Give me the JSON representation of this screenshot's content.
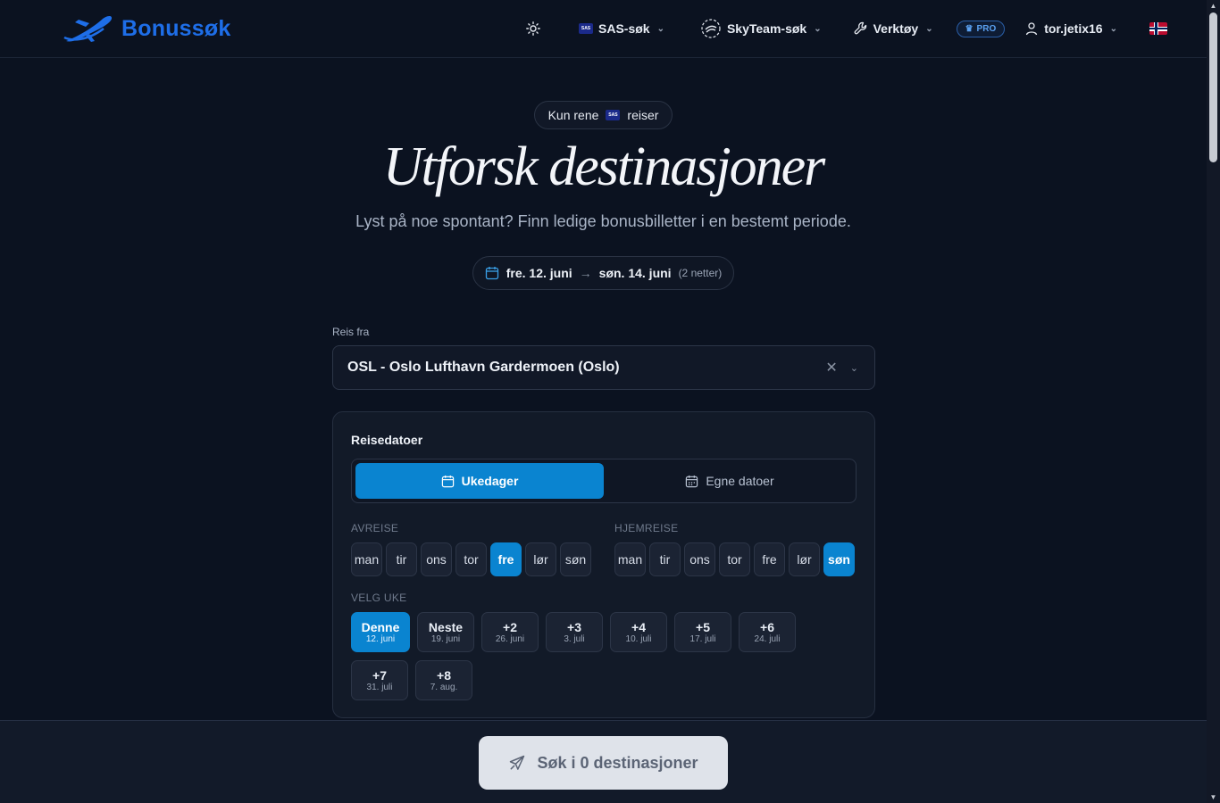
{
  "header": {
    "logo_text": "Bonussøk",
    "nav": {
      "sas": "SAS-søk",
      "skyteam": "SkyTeam-søk",
      "tools": "Verktøy",
      "pro": "PRO",
      "user": "tor.jetix16"
    },
    "sas_badge": "SAS"
  },
  "hero": {
    "pill_before": "Kun rene",
    "pill_after": "reiser",
    "title": "Utforsk destinasjoner",
    "subtitle": "Lyst på noe spontant? Finn ledige bonusbilletter i en bestemt periode.",
    "date_from": "fre. 12. juni",
    "date_to": "søn. 14. juni",
    "nights": "(2 netter)"
  },
  "from": {
    "label": "Reis fra",
    "value": "OSL - Oslo Lufthavn Gardermoen (Oslo)"
  },
  "travel_dates": {
    "title": "Reisedatoer",
    "tab_weekdays": "Ukedager",
    "tab_custom": "Egne datoer",
    "departure_label": "AVREISE",
    "return_label": "HJEMREISE",
    "departure_days": [
      "man",
      "tir",
      "ons",
      "tor",
      "fre",
      "lør",
      "søn"
    ],
    "departure_selected": "fre",
    "return_days": [
      "man",
      "tir",
      "ons",
      "tor",
      "fre",
      "lør",
      "søn"
    ],
    "return_selected": "søn",
    "week_label": "VELG UKE",
    "weeks": [
      {
        "t": "Denne",
        "s": "12. juni"
      },
      {
        "t": "Neste",
        "s": "19. juni"
      },
      {
        "t": "+2",
        "s": "26. juni"
      },
      {
        "t": "+3",
        "s": "3. juli"
      },
      {
        "t": "+4",
        "s": "10. juli"
      },
      {
        "t": "+5",
        "s": "17. juli"
      },
      {
        "t": "+6",
        "s": "24. juli"
      },
      {
        "t": "+7",
        "s": "31. juli"
      },
      {
        "t": "+8",
        "s": "7. aug."
      }
    ],
    "week_selected": 0
  },
  "search_button": "Søk i 0 destinasjoner",
  "colors": {
    "accent": "#0a84d0",
    "brand": "#1e6ee8",
    "background": "#0b1220"
  }
}
